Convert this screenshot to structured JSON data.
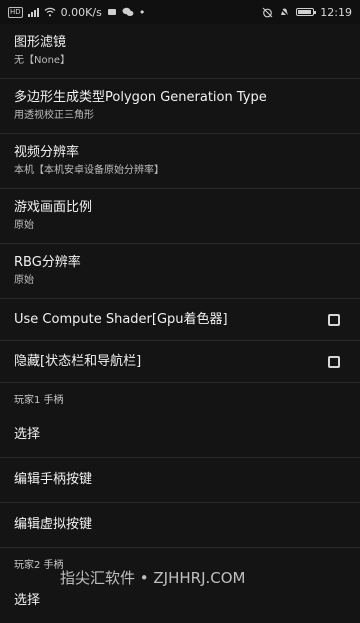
{
  "status_bar": {
    "left_badge": "HD",
    "network_speed": "0.00K/s",
    "time": "12:19"
  },
  "prefs": {
    "graphics_filter": {
      "title": "图形滤镜",
      "summary": "无【None】"
    },
    "polygon_type": {
      "title": "多边形生成类型Polygon Generation Type",
      "summary": "用透视校正三角形"
    },
    "video_resolution": {
      "title": "视频分辨率",
      "summary": "本机【本机安卓设备原始分辨率】"
    },
    "aspect_ratio": {
      "title": "游戏画面比例",
      "summary": "原始"
    },
    "rbg_resolution": {
      "title": "RBG分辨率",
      "summary": "原始"
    },
    "compute_shader": {
      "title": "Use Compute Shader[Gpu着色器]",
      "checked": false
    },
    "hide_bars": {
      "title": "隐藏[状态栏和导航栏]",
      "checked": false
    },
    "player1_category": "玩家1 手柄",
    "player1_select": "选择",
    "edit_gamepad_buttons": "编辑手柄按键",
    "edit_virtual_buttons": "编辑虚拟按键",
    "player2_category": "玩家2 手柄",
    "player2_select": "选择"
  },
  "watermark": "指尖汇软件 • ZJHHRJ.COM"
}
